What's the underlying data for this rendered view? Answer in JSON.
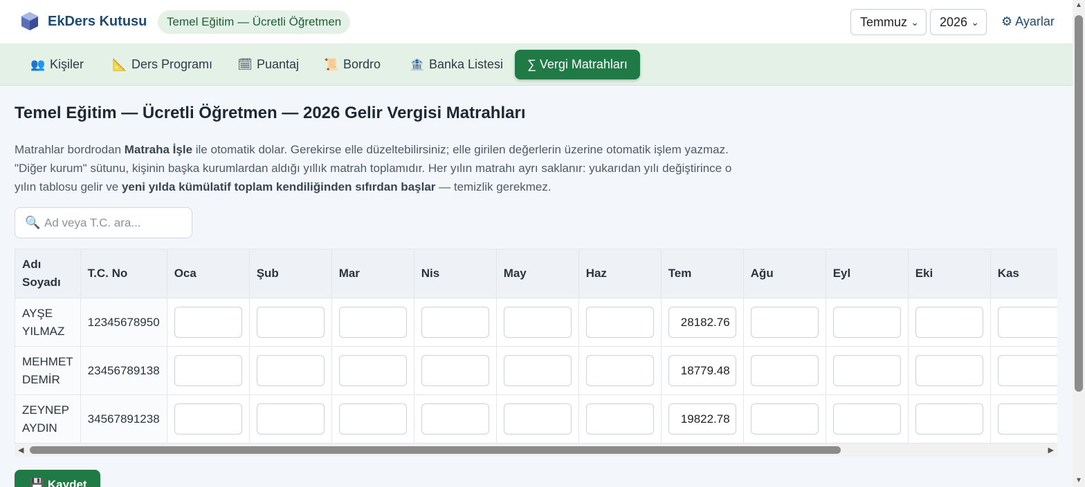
{
  "app": {
    "title": "EkDers Kutusu",
    "context": "Temel Eğitim — Ücretli Öğretmen",
    "month": "Temmuz",
    "year": "2026",
    "settings_label": "⚙ Ayarlar"
  },
  "nav": {
    "tabs": [
      {
        "icon": "👥",
        "label": "Kişiler"
      },
      {
        "icon": "📐",
        "label": "Ders Programı"
      },
      {
        "icon": "🗓",
        "label": "Puantaj"
      },
      {
        "icon": "📜",
        "label": "Bordro"
      },
      {
        "icon": "🏦",
        "label": "Banka Listesi"
      },
      {
        "label": "∑ Vergi Matrahları",
        "active": true
      }
    ]
  },
  "main": {
    "title": "Temel Eğitim — Ücretli Öğretmen — 2026 Gelir Vergisi Matrahları",
    "desc": {
      "p1": "Matrahlar bordrodan ",
      "b1": "Matraha İşle",
      "p2": " ile otomatik dolar. Gerekirse elle düzeltebilirsiniz; elle girilen değerlerin üzerine otomatik işlem yazmaz. \"Diğer kurum\" sütunu, kişinin başka kurumlardan aldığı yıllık matrah toplamıdır. Her yılın matrahı ayrı saklanır: yukarıdan yılı değiştirince o yılın tablosu gelir ve ",
      "b2": "yeni yılda kümülatif toplam kendiliğinden sıfırdan başlar",
      "p3": " — temizlik gerekmez."
    },
    "search_placeholder": "Ad veya T.C. ara...",
    "save_label": "Kaydet"
  },
  "table": {
    "headers": {
      "name": "Adı Soyadı",
      "tc": "T.C. No",
      "months": [
        "Oca",
        "Şub",
        "Mar",
        "Nis",
        "May",
        "Haz",
        "Tem",
        "Ağu",
        "Eyl",
        "Eki",
        "Kas"
      ]
    },
    "rows": [
      {
        "name_first": "AYŞE",
        "name_last": "YILMAZ",
        "tc": "12345678950",
        "values": [
          "",
          "",
          "",
          "",
          "",
          "",
          "28182.76",
          "",
          "",
          "",
          ""
        ]
      },
      {
        "name_first": "MEHMET",
        "name_last": "DEMİR",
        "tc": "23456789138",
        "values": [
          "",
          "",
          "",
          "",
          "",
          "",
          "18779.48",
          "",
          "",
          "",
          ""
        ]
      },
      {
        "name_first": "ZEYNEP",
        "name_last": "AYDIN",
        "tc": "34567891238",
        "values": [
          "",
          "",
          "",
          "",
          "",
          "",
          "19822.78",
          "",
          "",
          "",
          ""
        ]
      }
    ]
  },
  "colors": {
    "brand": "#1d4a73",
    "accent_green": "#1f7a45",
    "nav_bg": "#e4f1e7"
  }
}
